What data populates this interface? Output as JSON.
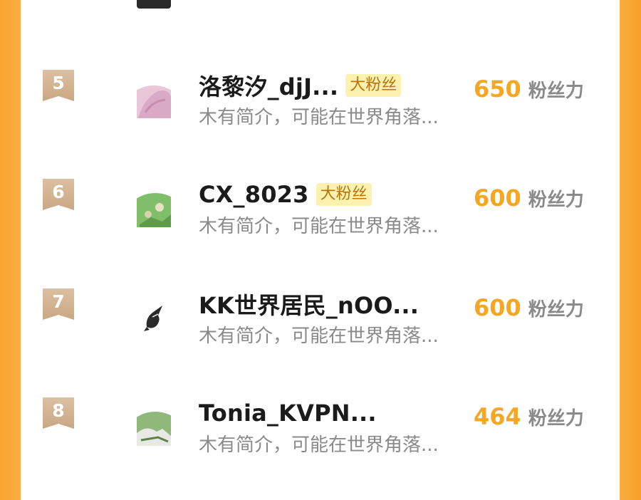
{
  "list": {
    "unit_label": "粉丝力",
    "items": [
      {
        "rank": "5",
        "name": "洛黎汐_djJ...",
        "tag": "大粉丝",
        "description": "木有简介，可能在世界角落...",
        "score": "650",
        "avatar_icon": "avatar-pink"
      },
      {
        "rank": "6",
        "name": "CX_8023",
        "tag": "大粉丝",
        "description": "木有简介，可能在世界角落...",
        "score": "600",
        "avatar_icon": "avatar-green"
      },
      {
        "rank": "7",
        "name": "KK世界居民_nOO...",
        "tag": "",
        "description": "木有简介，可能在世界角落...",
        "score": "600",
        "avatar_icon": "avatar-bird"
      },
      {
        "rank": "8",
        "name": "Tonia_KVPN...",
        "tag": "",
        "description": "木有简介，可能在世界角落...",
        "score": "464",
        "avatar_icon": "avatar-photo"
      }
    ]
  },
  "colors": {
    "accent_orange": "#f5a623",
    "badge_bronze": "#c9a783",
    "tag_bg": "#fdf1b0",
    "frame_orange": "#fcae42"
  }
}
